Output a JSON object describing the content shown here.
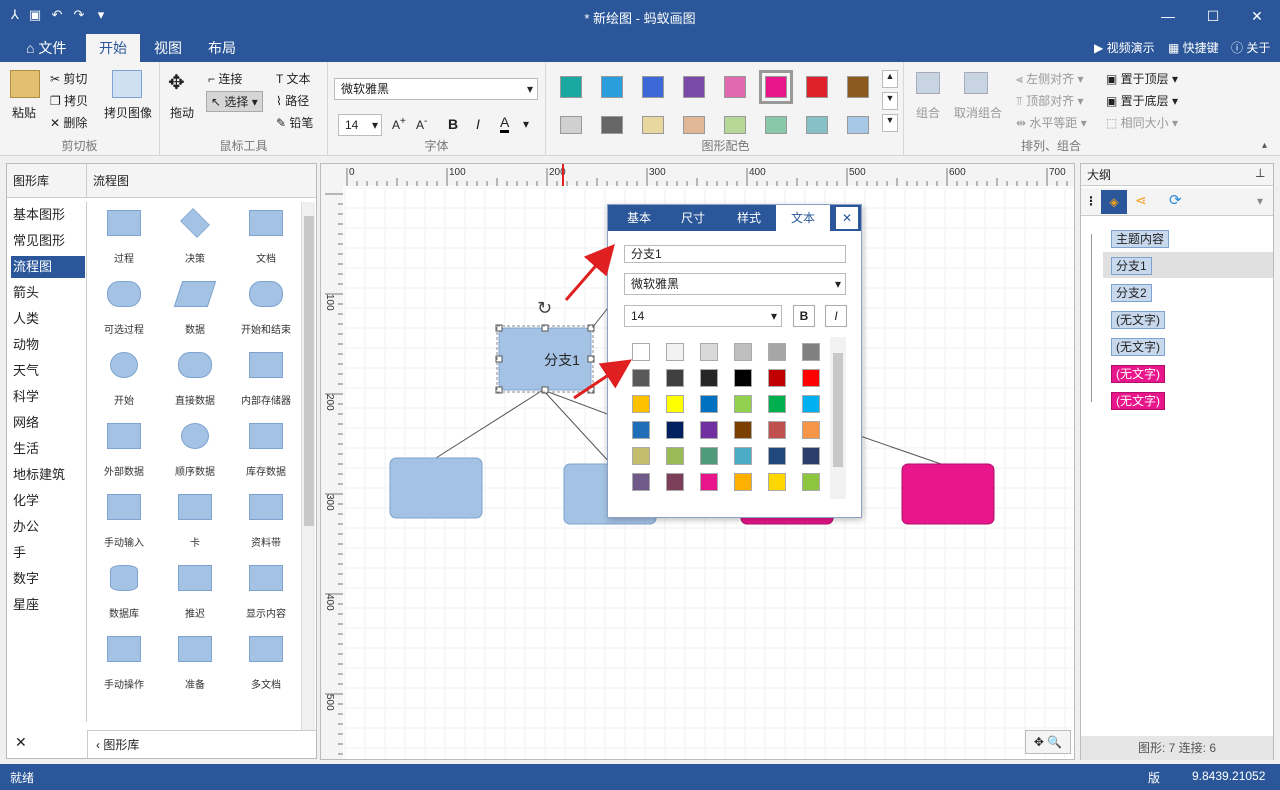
{
  "title": "* 新绘图 - 蚂蚁画图",
  "menu": {
    "tabs": [
      "文件",
      "开始",
      "视图",
      "布局"
    ],
    "right": [
      "视频演示",
      "快捷键",
      "关于"
    ]
  },
  "ribbon": {
    "clipboard": {
      "label": "剪切板",
      "paste": "粘贴",
      "cut": "剪切",
      "copy": "拷贝",
      "delete": "删除",
      "copy_image": "拷贝图像"
    },
    "mouse": {
      "label": "鼠标工具",
      "drag": "拖动",
      "connect": "连接",
      "select": "选择",
      "text": "文本",
      "path": "路径",
      "pencil": "铅笔"
    },
    "font": {
      "label": "字体",
      "family": "微软雅黑",
      "size": "14",
      "bold": "B",
      "italic": "I",
      "color": "A"
    },
    "colors": {
      "label": "图形配色",
      "row1": [
        "#1aa9a0",
        "#2a9ddc",
        "#3d68d8",
        "#7a4aa8",
        "#e06ab0",
        "#e8168a",
        "#e0202a",
        "#8a5a1e"
      ],
      "row2": [
        "#d0d0d0",
        "#666666",
        "#e8d8a0",
        "#e0b898",
        "#b8d898",
        "#88c8a8",
        "#88c0c8",
        "#a8c8e8"
      ]
    },
    "arrange": {
      "label": "排列、组合",
      "group": "组合",
      "ungroup": "取消组合",
      "left_align": "左侧对齐",
      "top_align": "顶部对齐",
      "h_space": "水平等距",
      "to_top": "置于顶层",
      "to_bottom": "置于底层",
      "same_size": "相同大小"
    }
  },
  "library": {
    "header_left": "图形库",
    "header_right": "流程图",
    "categories": [
      "基本图形",
      "常见图形",
      "流程图",
      "箭头",
      "人类",
      "动物",
      "天气",
      "科学",
      "网络",
      "生活",
      "地标建筑",
      "化学",
      "办公",
      "手",
      "数字",
      "星座"
    ],
    "shapes": [
      "过程",
      "决策",
      "文档",
      "可选过程",
      "数据",
      "开始和结束",
      "开始",
      "直接数据",
      "内部存储器",
      "外部数据",
      "顺序数据",
      "库存数据",
      "手动输入",
      "卡",
      "资料带",
      "数据库",
      "推迟",
      "显示内容",
      "手动操作",
      "准备",
      "多文档"
    ],
    "footer": "图形库",
    "close": "✕"
  },
  "ruler": {
    "h": [
      "0",
      "100",
      "200",
      "300",
      "400",
      "500",
      "600",
      "700"
    ],
    "v": [
      "100",
      "200",
      "300",
      "400",
      "500"
    ]
  },
  "canvas": {
    "selected_label": "分支1"
  },
  "popup": {
    "tabs": [
      "基本",
      "尺寸",
      "样式",
      "文本"
    ],
    "text_value": "分支1",
    "font": "微软雅黑",
    "size": "14",
    "bold": "B",
    "italic": "I",
    "palette": [
      [
        "#ffffff",
        "#f2f2f2",
        "#d9d9d9",
        "#bfbfbf",
        "#a6a6a6",
        "#808080"
      ],
      [
        "#595959",
        "#404040",
        "#262626",
        "#000000",
        "#c00000",
        "#ff0000"
      ],
      [
        "#ffc000",
        "#ffff00",
        "#0070c0",
        "#92d050",
        "#00b050",
        "#00b0f0"
      ],
      [
        "#1f6fb8",
        "#002060",
        "#7030a0",
        "#7b3f00",
        "#c0504d",
        "#f79646"
      ],
      [
        "#c4bd70",
        "#9bbb59",
        "#4e9a7a",
        "#4bacc6",
        "#1f497d",
        "#2c3e6b"
      ],
      [
        "#6f5a8a",
        "#7b3f5a",
        "#e8168a",
        "#ffb000",
        "#ffd700",
        "#8cc63f"
      ]
    ]
  },
  "outline": {
    "title": "大纲",
    "nodes": [
      {
        "label": "主题内容",
        "pink": false
      },
      {
        "label": "分支1",
        "pink": false
      },
      {
        "label": "分支2",
        "pink": false
      },
      {
        "label": "(无文字)",
        "pink": false
      },
      {
        "label": "(无文字)",
        "pink": false
      },
      {
        "label": "(无文字)",
        "pink": true
      },
      {
        "label": "(无文字)",
        "pink": true
      }
    ],
    "stats": "图形: 7   连接: 6"
  },
  "status": {
    "left": "就绪",
    "version": "版",
    "version_number": "9.8439.21052"
  },
  "colors": {
    "accent": "#2b579a",
    "pink": "#e8168a",
    "shape": "#a4c2e4"
  }
}
